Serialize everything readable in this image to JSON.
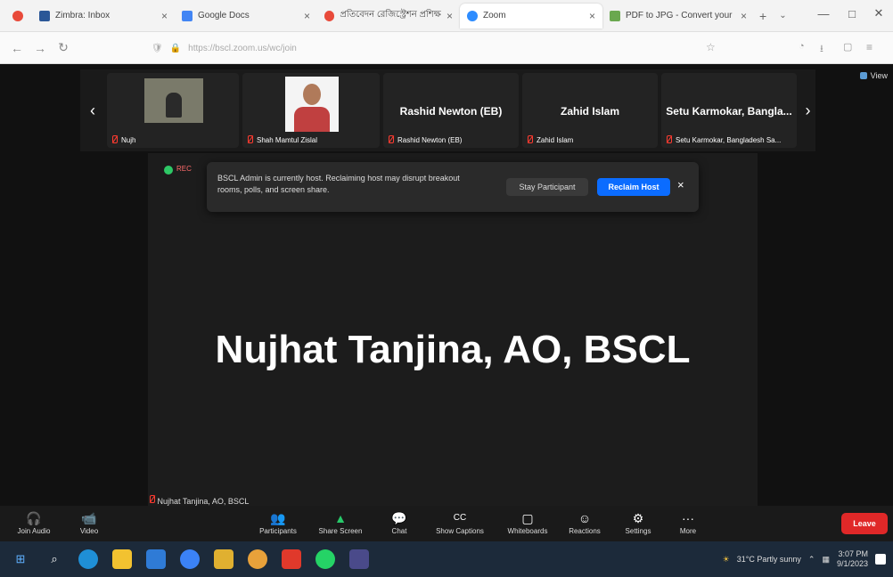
{
  "browser": {
    "tabs": [
      {
        "title": "Zimbra: Inbox",
        "color": "#2b5797",
        "active": false
      },
      {
        "title": "Google Docs",
        "color": "#4285f4",
        "active": false
      },
      {
        "title": "প্রতিবেদন রেজিস্ট্রেশন প্রশিক্ষণ",
        "color": "#e84a3a",
        "active": false
      },
      {
        "title": "Zoom",
        "color": "#2d8cff",
        "active": true
      },
      {
        "title": "PDF to JPG - Convert your PDF",
        "color": "#6aa84f",
        "active": false
      }
    ],
    "url": "https://bscl.zoom.us/wc/join",
    "win_controls": [
      "—",
      "□",
      "✕"
    ]
  },
  "gallery": {
    "participants": [
      {
        "display_name": "",
        "label": "Nujh"
      },
      {
        "display_name": "",
        "label": "Shah Mamtul Zislal"
      },
      {
        "display_name": "Rashid Newton (EB)",
        "label": "Rashid Newton (EB)"
      },
      {
        "display_name": "Zahid Islam",
        "label": "Zahid Islam"
      },
      {
        "display_name": "Setu Karmokar, Bangla...",
        "label": "Setu Karmokar, Bangladesh Sa..."
      }
    ],
    "prev_arrow": "‹",
    "next_arrow": "›",
    "view_label": "View"
  },
  "notice": {
    "rec_label": "REC",
    "message": "BSCL Admin is currently host. Reclaiming host may disrupt breakout rooms, polls, and screen share.",
    "stay_button": "Stay Participant",
    "reclaim_button": "Reclaim Host",
    "close": "×"
  },
  "speaker": {
    "name": "Nujhat Tanjina, AO, BSCL",
    "tag": "Nujhat Tanjina, AO, BSCL"
  },
  "toolbar": {
    "items": [
      {
        "label": "Join Audio",
        "icon": "headphones-icon",
        "glyph": "🎧"
      },
      {
        "label": "Video",
        "icon": "video-icon",
        "glyph": "📹"
      },
      {
        "label": "Participants",
        "icon": "participants-icon",
        "glyph": "👥"
      },
      {
        "label": "Share Screen",
        "icon": "share-screen-icon",
        "glyph": "▲"
      },
      {
        "label": "Chat",
        "icon": "chat-icon",
        "glyph": "💬"
      },
      {
        "label": "Show Captions",
        "icon": "captions-icon",
        "glyph": "CC"
      },
      {
        "label": "Whiteboards",
        "icon": "whiteboard-icon",
        "glyph": "▢"
      },
      {
        "label": "Reactions",
        "icon": "reactions-icon",
        "glyph": "☺"
      },
      {
        "label": "Settings",
        "icon": "gear-icon",
        "glyph": "⚙"
      },
      {
        "label": "More",
        "icon": "more-icon",
        "glyph": "···"
      }
    ],
    "leave": "Leave"
  },
  "taskbar": {
    "weather": "31°C Partly sunny",
    "time": "3:07 PM",
    "date": "9/1/2023"
  }
}
